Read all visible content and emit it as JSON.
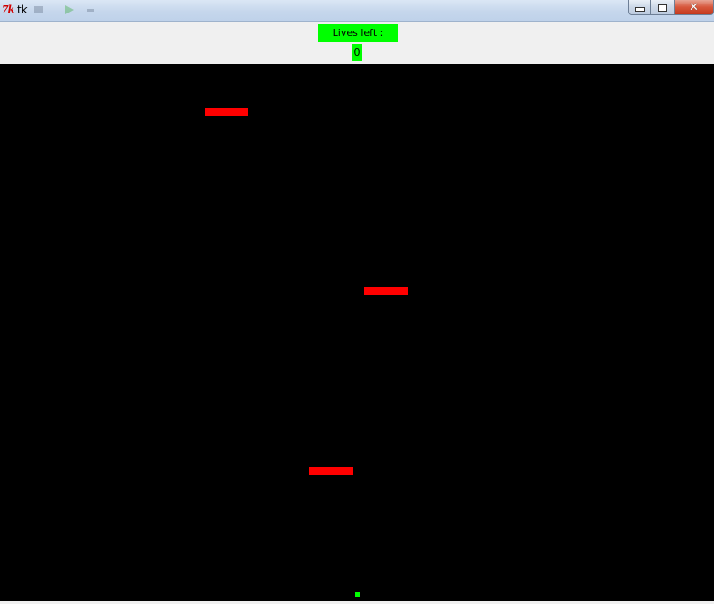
{
  "window": {
    "title": "tk",
    "logo_text": "7k",
    "close_glyph": "✕"
  },
  "hud": {
    "lives_label": "Lives left :",
    "lives_value": "0"
  },
  "game": {
    "background": "#000000",
    "brick_color": "#ff0000",
    "ball_color": "#00ff00",
    "hud_color": "#00ff00",
    "brick_count": 3
  }
}
